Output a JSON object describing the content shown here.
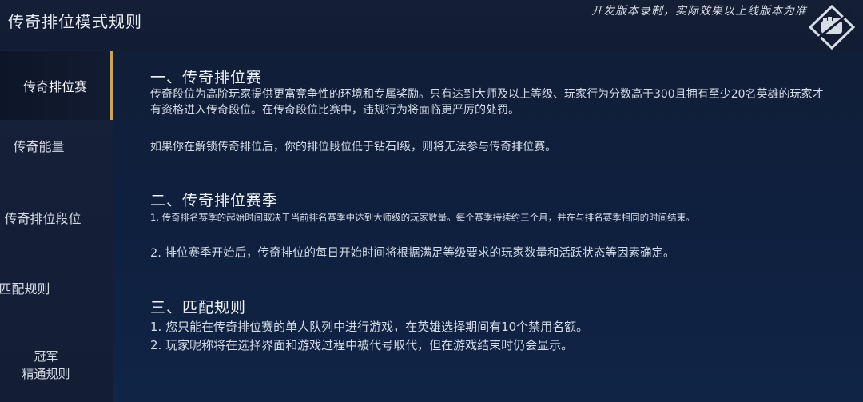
{
  "header": {
    "title": "传奇排位模式规则",
    "watermark": "开发版本录制，实际效果以上线版本为准"
  },
  "sidebar": {
    "items": [
      {
        "label": "传奇排位赛",
        "active": true
      },
      {
        "label": "传奇能量",
        "active": false
      },
      {
        "label": "传奇排位段位",
        "active": false
      },
      {
        "label": "匹配规则",
        "active": false
      },
      {
        "label": "冠军\n精通规则",
        "line1": "冠军",
        "line2": "精通规则",
        "active": false
      }
    ]
  },
  "sections": [
    {
      "title": "一、传奇排位赛",
      "paragraphs": [
        "传奇段位为高阶玩家提供更富竞争性的环境和专属奖励。只有达到大师及以上等级、玩家行为分数高于300且拥有至少20名英雄的玩家才有资格进入传奇段位。在传奇段位比赛中，违规行为将面临更严厉的处罚。",
        "如果你在解锁传奇排位后，你的排位段位低于钻石I级，则将无法参与传奇排位赛。"
      ]
    },
    {
      "title": "二、传奇排位赛季",
      "paragraphs": [
        "1. 传奇排名赛季的起始时间取决于当前排名赛季中达到大师级的玩家数量。每个赛季持续约三个月，并在与排名赛季相同的时间结束。",
        "2. 排位赛季开始后，传奇排位的每日开始时间将根据满足等级要求的玩家数量和活跃状态等因素确定。"
      ]
    },
    {
      "title": "三、匹配规则",
      "paragraphs": [
        "1. 您只能在传奇排位赛的单人队列中进行游戏，在英雄选择期间有10个禁用名额。",
        "2. 玩家昵称将在选择界面和游戏过程中被代号取代，但在游戏结束时仍会显示。"
      ]
    }
  ],
  "colors": {
    "accent_gold": "#c9a55a",
    "background": "#0f1f3d",
    "text": "#d4dbe7"
  }
}
